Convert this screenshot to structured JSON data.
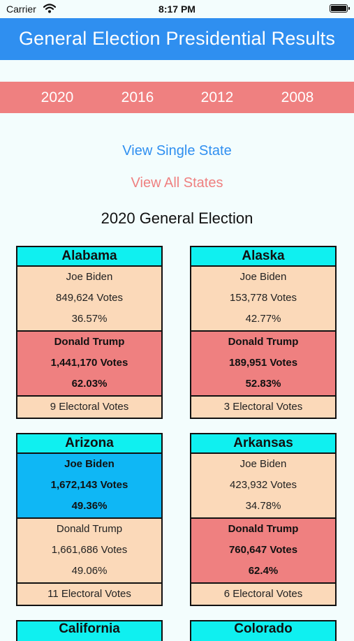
{
  "status": {
    "carrier": "Carrier",
    "time": "8:17 PM"
  },
  "header": {
    "title": "General Election Presidential Results"
  },
  "years": [
    "2020",
    "2016",
    "2012",
    "2008"
  ],
  "links": {
    "single_state": "View Single State",
    "all_states": "View All States"
  },
  "section_title": "2020 General Election",
  "colors": {
    "primary": "#2f8ff0",
    "accent": "#ef8080",
    "state_header": "#0ff0f0",
    "dem_win": "#0fb7f5",
    "neutral": "#fbd9b9"
  },
  "states": [
    {
      "name": "Alabama",
      "candidate1": {
        "name": "Joe Biden",
        "votes": "849,624 Votes",
        "pct": "36.57%"
      },
      "candidate2": {
        "name": "Donald Trump",
        "votes": "1,441,170 Votes",
        "pct": "62.03%"
      },
      "electoral": "9 Electoral Votes"
    },
    {
      "name": "Alaska",
      "candidate1": {
        "name": "Joe Biden",
        "votes": "153,778 Votes",
        "pct": "42.77%"
      },
      "candidate2": {
        "name": "Donald Trump",
        "votes": "189,951 Votes",
        "pct": "52.83%"
      },
      "electoral": "3 Electoral Votes"
    },
    {
      "name": "Arizona",
      "candidate1": {
        "name": "Joe Biden",
        "votes": "1,672,143 Votes",
        "pct": "49.36%"
      },
      "candidate2": {
        "name": "Donald Trump",
        "votes": "1,661,686 Votes",
        "pct": "49.06%"
      },
      "electoral": "11 Electoral Votes"
    },
    {
      "name": "Arkansas",
      "candidate1": {
        "name": "Joe Biden",
        "votes": "423,932 Votes",
        "pct": "34.78%"
      },
      "candidate2": {
        "name": "Donald Trump",
        "votes": "760,647 Votes",
        "pct": "62.4%"
      },
      "electoral": "6 Electoral Votes"
    },
    {
      "name": "California"
    },
    {
      "name": "Colorado"
    }
  ]
}
